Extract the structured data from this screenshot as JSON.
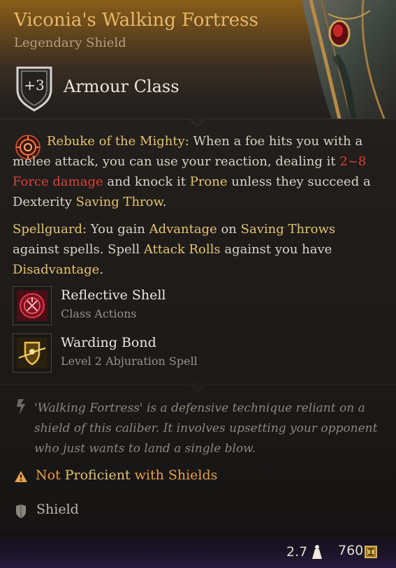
{
  "item": {
    "name": "Viconia's Walking Fortress",
    "rarity_type": "Legendary Shield",
    "armour_class_value": "+3",
    "armour_class_label": "Armour Class"
  },
  "rebuke": {
    "icon": "rebuke-sigil-icon",
    "name": "Rebuke of the Mighty:",
    "t1": " When a foe hits you with a melee attack, you can use your reaction, dealing it ",
    "damage": "2~8 Force damage",
    "t2": " and knock it ",
    "prone": "Prone",
    "t3": " unless they succeed a Dexterity ",
    "saving_throw": "Saving Throw",
    "t4": "."
  },
  "spellguard": {
    "name": "Spellguard:",
    "t1": " You gain ",
    "advantage": "Advantage",
    "t2": " on ",
    "saving_throws": "Saving Throws",
    "t3": " against spells. Spell ",
    "attack_rolls": "Attack Rolls",
    "t4": " against you have ",
    "disadvantage": "Disadvantage",
    "t5": "."
  },
  "actions": [
    {
      "name": "Reflective Shell",
      "sub": "Class Actions",
      "icon": "reflective-shell-icon"
    },
    {
      "name": "Warding Bond",
      "sub": "Level 2 Abjuration Spell",
      "icon": "warding-bond-icon"
    }
  ],
  "lore": "'Walking Fortress' is a defensive technique reliant on a shield of this caliber. It involves upsetting your opponent who just wants to land a single blow.",
  "warning": {
    "part1": "Not ",
    "part2": "Proficient",
    "part3": " with Shields"
  },
  "category": "Shield",
  "footer": {
    "weight": "2.7",
    "price": "760"
  },
  "colors": {
    "title": "#e8b768",
    "keyword": "#e7c36d",
    "damage": "#d8423a",
    "warning": "#e7a04a"
  }
}
